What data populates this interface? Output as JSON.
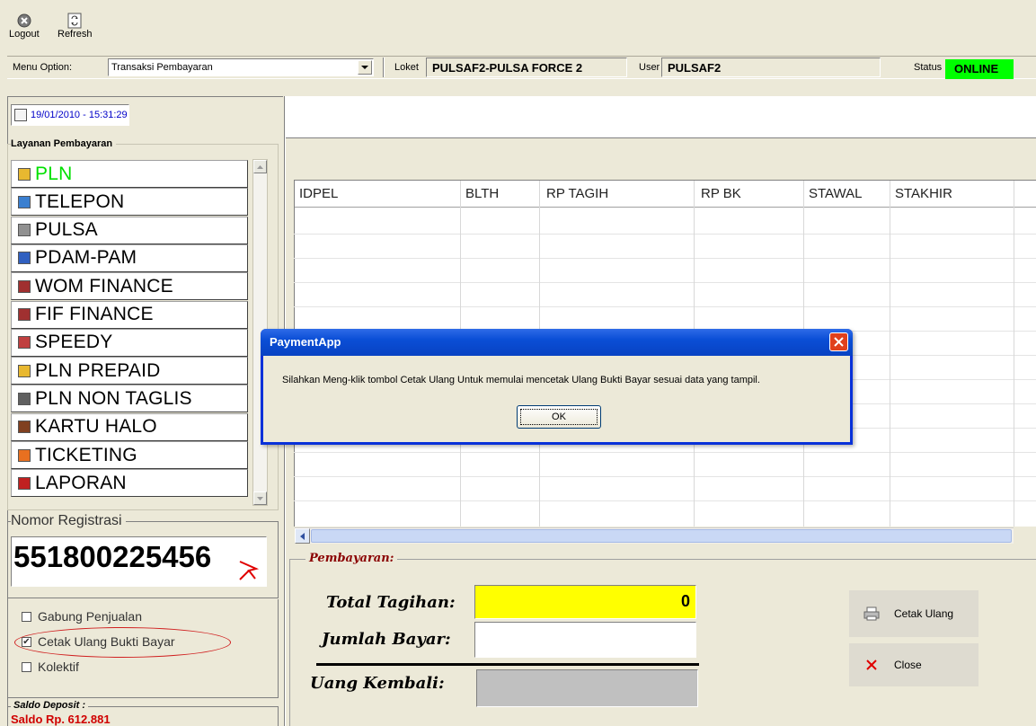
{
  "toolbar": {
    "logout_label": "Logout",
    "refresh_label": "Refresh"
  },
  "header": {
    "menu_option_label": "Menu Option:",
    "menu_option_value": "Transaksi Pembayaran",
    "loket_label": "Loket",
    "loket_value": "PULSAF2-PULSA FORCE 2",
    "user_label": "User",
    "user_value": "PULSAF2",
    "status_label": "Status",
    "status_value": "ONLINE",
    "status_color": "#00ff00"
  },
  "sidebar": {
    "datetime": "19/01/2010 - 15:31:29",
    "services_title": "Layanan Pembayaran",
    "services": [
      {
        "label": "PLN",
        "icon": "pln-icon",
        "color": "#00e000"
      },
      {
        "label": "TELEPON",
        "icon": "telepon-icon",
        "color": "#000000"
      },
      {
        "label": "PULSA",
        "icon": "pulsa-icon",
        "color": "#000000"
      },
      {
        "label": "PDAM-PAM",
        "icon": "pdam-icon",
        "color": "#000000"
      },
      {
        "label": "WOM FINANCE",
        "icon": "wom-icon",
        "color": "#000000"
      },
      {
        "label": "FIF FINANCE",
        "icon": "fif-icon",
        "color": "#000000"
      },
      {
        "label": "SPEEDY",
        "icon": "speedy-icon",
        "color": "#000000"
      },
      {
        "label": "PLN PREPAID",
        "icon": "pln-prepaid-icon",
        "color": "#000000"
      },
      {
        "label": "PLN NON TAGLIS",
        "icon": "pln-nontaglis-icon",
        "color": "#000000"
      },
      {
        "label": "KARTU HALO",
        "icon": "kartu-halo-icon",
        "color": "#000000"
      },
      {
        "label": "TICKETING",
        "icon": "ticketing-icon",
        "color": "#000000"
      },
      {
        "label": "LAPORAN",
        "icon": "laporan-icon",
        "color": "#000000"
      }
    ],
    "registrasi_title": "Nomor Registrasi",
    "registrasi_value": "551800225456",
    "options": [
      {
        "label": "Gabung Penjualan",
        "checked": false
      },
      {
        "label": "Cetak Ulang Bukti Bayar",
        "checked": true
      },
      {
        "label": "Kolektif",
        "checked": false
      }
    ],
    "saldo_title": "Saldo Deposit :",
    "saldo_value": "Saldo Rp. 612.881"
  },
  "table": {
    "columns": [
      "IDPEL",
      "BLTH",
      "RP TAGIH",
      "RP BK",
      "STAWAL",
      "STAKHIR"
    ]
  },
  "payment": {
    "section_title": "Pembayaran:",
    "total_label": "Total Tagihan:",
    "total_value": "0",
    "jumlah_label": "Jumlah Bayar:",
    "jumlah_value": "",
    "kembali_label": "Uang Kembali:",
    "kembali_value": "",
    "cetak_label": "Cetak Ulang",
    "close_label": "Close"
  },
  "dialog": {
    "title": "PaymentApp",
    "message": "Silahkan Meng-klik tombol Cetak Ulang Untuk memulai mencetak Ulang Bukti Bayar sesuai data yang tampil.",
    "ok_label": "OK"
  }
}
